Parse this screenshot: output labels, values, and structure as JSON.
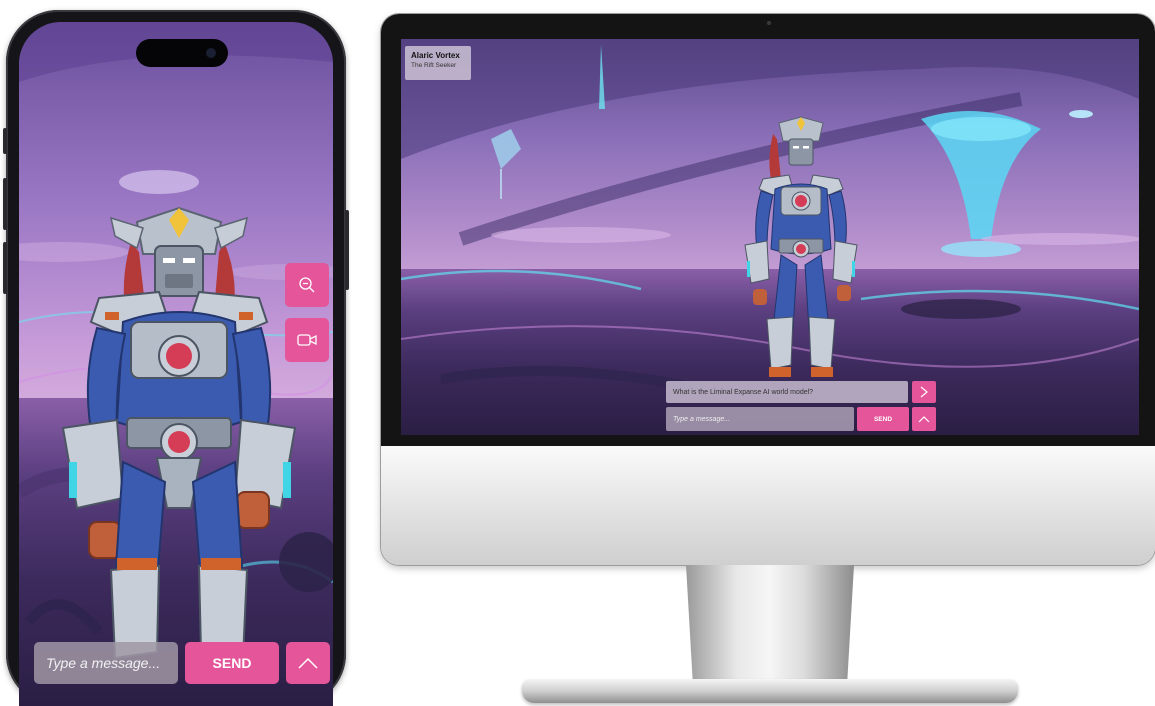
{
  "phone": {
    "input_placeholder": "Type a message...",
    "send_label": "SEND",
    "icons": [
      "zoom-out-icon",
      "video-camera-icon",
      "chevron-up-icon"
    ]
  },
  "desktop": {
    "character": {
      "name": "Alaric Vortex",
      "subtitle": "The Rift Seeker"
    },
    "suggested_message": "What is the Liminal Expanse AI world model?",
    "input_placeholder": "Type a message...",
    "send_label": "SEND",
    "icons": [
      "chevron-right-icon",
      "chevron-up-icon"
    ]
  },
  "colors": {
    "accent": "#e4559a",
    "sky": "#9a77c4",
    "ground": "#3c2a5c",
    "robot_body": "#3b5bb0",
    "robot_armor": "#a9b3bf",
    "robot_trim": "#d0622c"
  }
}
